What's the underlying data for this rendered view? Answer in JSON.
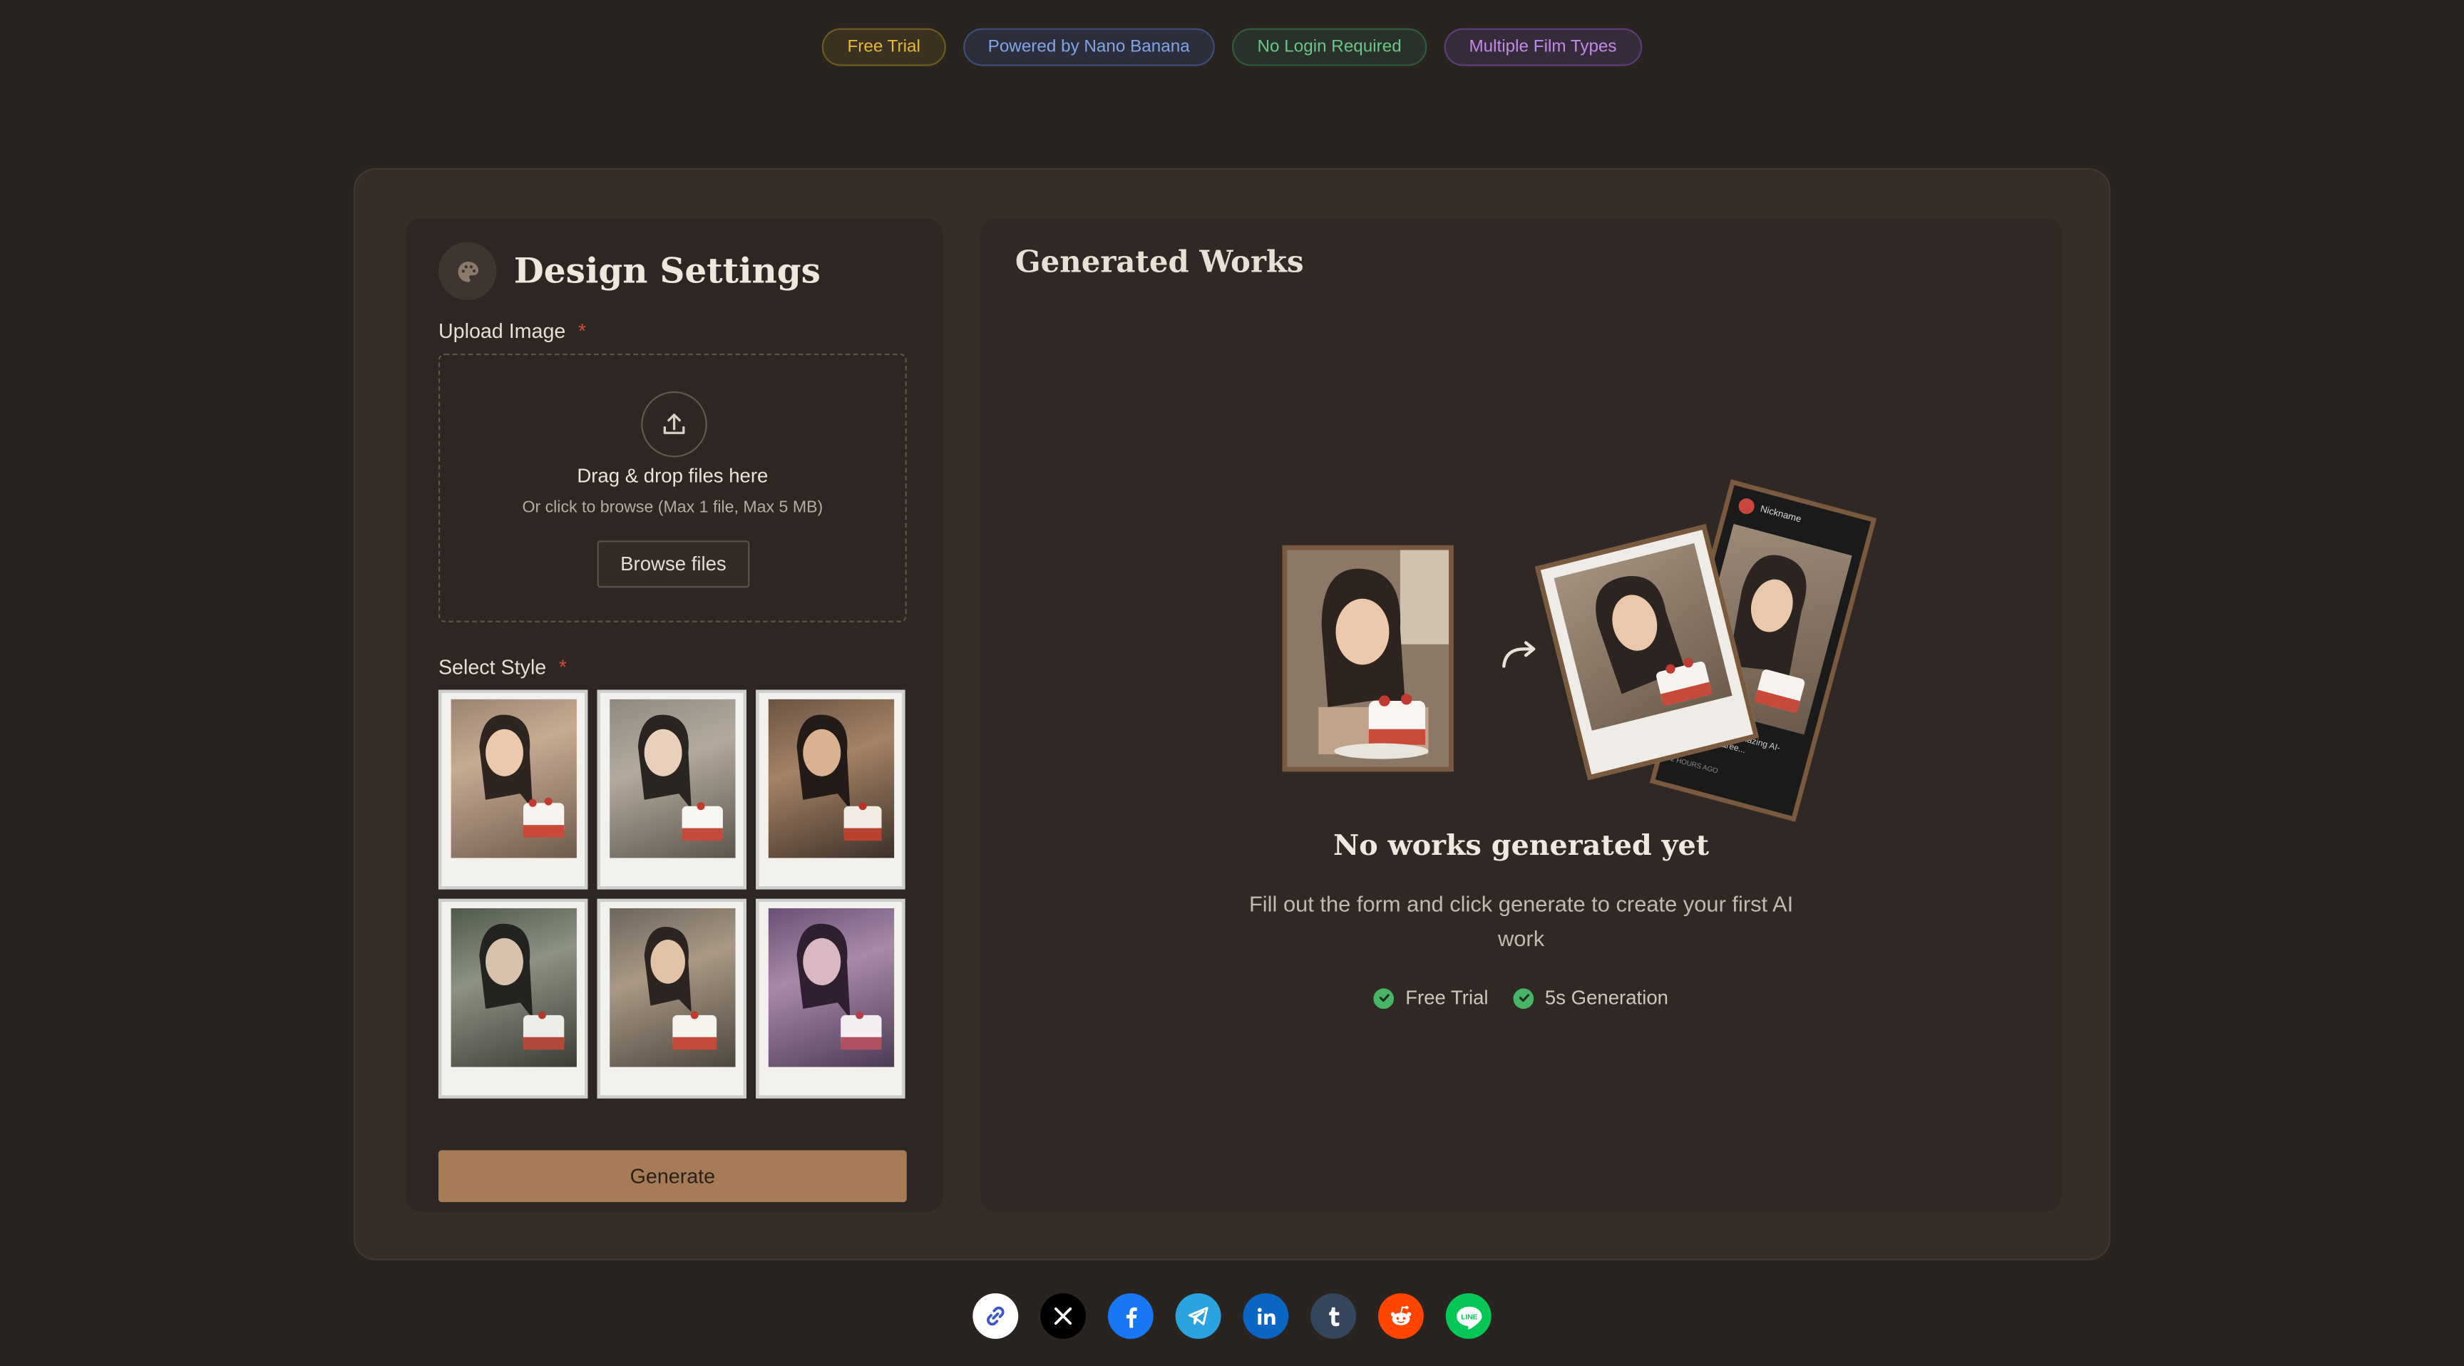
{
  "badges": [
    "Free Trial",
    "Powered by Nano Banana",
    "No Login Required",
    "Multiple Film Types"
  ],
  "design": {
    "title": "Design Settings",
    "upload_label": "Upload Image",
    "required_mark": "*",
    "dropzone_title": "Drag & drop files here",
    "dropzone_sub": "Or click to browse (Max 1 file, Max 5 MB)",
    "browse_label": "Browse files",
    "style_label": "Select Style",
    "generate_label": "Generate"
  },
  "works": {
    "title": "Generated Works",
    "empty_title": "No works generated yet",
    "empty_desc": "Fill out the form and click generate to create your first AI work",
    "features": [
      "Free Trial",
      "5s Generation"
    ],
    "preview_nickname": "Nickname",
    "preview_caption": "Check out this amazing AI-generated saree...",
    "preview_time": "2 HOURS AGO"
  },
  "share_icons": [
    "link-icon",
    "x-icon",
    "facebook-icon",
    "telegram-icon",
    "linkedin-icon",
    "tumblr-icon",
    "reddit-icon",
    "line-icon"
  ],
  "colors": {
    "accent": "#a67b55",
    "background": "#2a2420",
    "panel": "#342d28"
  }
}
